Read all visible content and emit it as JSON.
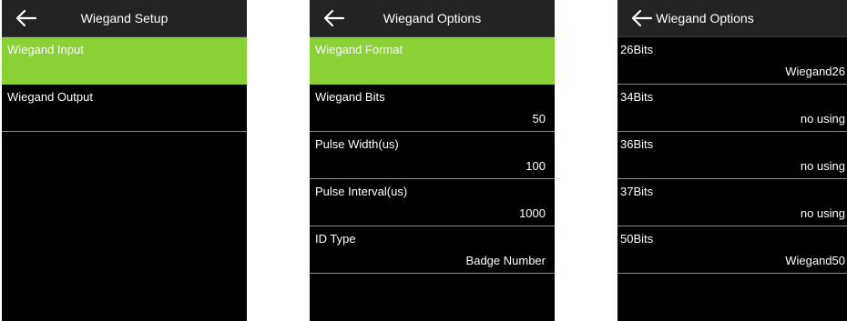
{
  "screens": [
    {
      "title": "Wiegand Setup",
      "rows": [
        {
          "label": "Wiegand Input",
          "value": ""
        },
        {
          "label": "Wiegand Output",
          "value": ""
        }
      ]
    },
    {
      "title": "Wiegand Options",
      "rows": [
        {
          "label": "Wiegand Format",
          "value": ""
        },
        {
          "label": "Wiegand Bits",
          "value": "50"
        },
        {
          "label": "Pulse Width(us)",
          "value": "100"
        },
        {
          "label": "Pulse Interval(us)",
          "value": "1000"
        },
        {
          "label": "ID Type",
          "value": "Badge Number"
        }
      ]
    },
    {
      "title": "Wiegand Options",
      "rows": [
        {
          "label": "26Bits",
          "value": "Wiegand26"
        },
        {
          "label": "34Bits",
          "value": "no using"
        },
        {
          "label": "36Bits",
          "value": "no using"
        },
        {
          "label": "37Bits",
          "value": "no using"
        },
        {
          "label": "50Bits",
          "value": "Wiegand50"
        }
      ]
    }
  ],
  "colors": {
    "selected_row": "#8ad136",
    "background": "#000000",
    "topbar": "#232323",
    "divider": "#8c8c8c"
  },
  "icons": {
    "back": "arrow-left-icon"
  }
}
